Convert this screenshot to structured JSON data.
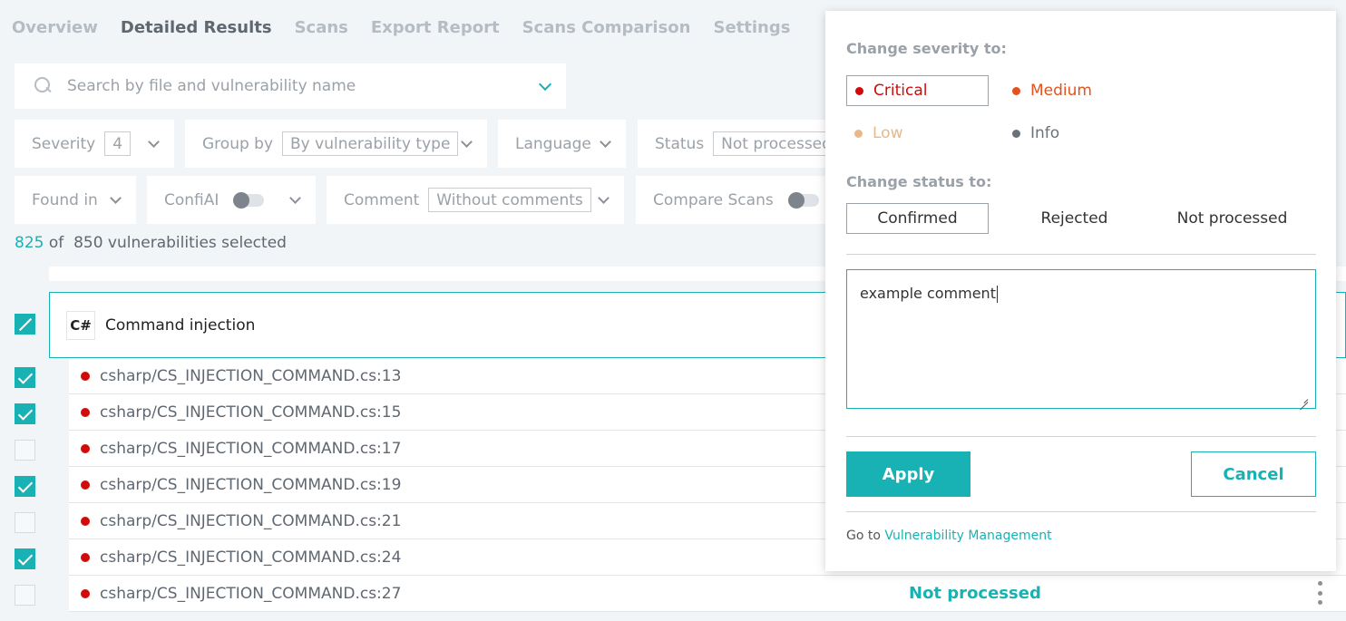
{
  "tabs": [
    {
      "label": "Overview"
    },
    {
      "label": "Detailed Results"
    },
    {
      "label": "Scans"
    },
    {
      "label": "Export Report"
    },
    {
      "label": "Scans Comparison"
    },
    {
      "label": "Settings"
    }
  ],
  "search": {
    "placeholder": "Search by file and vulnerability name"
  },
  "filters": {
    "severity": {
      "label": "Severity",
      "value": "4"
    },
    "group_by": {
      "label": "Group by",
      "value": "By vulnerability type"
    },
    "language": {
      "label": "Language"
    },
    "status": {
      "label": "Status",
      "value": "Not processed"
    },
    "found_in": {
      "label": "Found in"
    },
    "confiai": {
      "label": "ConfiAI"
    },
    "comment": {
      "label": "Comment",
      "value": "Without comments"
    },
    "compare_scans": {
      "label": "Compare Scans"
    }
  },
  "selection": {
    "selected": "825",
    "of_label": "of",
    "total_text": "850 vulnerabilities selected"
  },
  "group": {
    "lang_icon": "C#",
    "title": "Command injection"
  },
  "rows": [
    {
      "file": "csharp/CS_INJECTION_COMMAND.cs:13",
      "checked": true
    },
    {
      "file": "csharp/CS_INJECTION_COMMAND.cs:15",
      "checked": true
    },
    {
      "file": "csharp/CS_INJECTION_COMMAND.cs:17",
      "checked": false
    },
    {
      "file": "csharp/CS_INJECTION_COMMAND.cs:19",
      "checked": true
    },
    {
      "file": "csharp/CS_INJECTION_COMMAND.cs:21",
      "checked": false
    },
    {
      "file": "csharp/CS_INJECTION_COMMAND.cs:24",
      "checked": true
    },
    {
      "file": "csharp/CS_INJECTION_COMMAND.cs:27",
      "checked": false
    }
  ],
  "last_row_status": "Not processed",
  "panel": {
    "severity_heading": "Change severity to:",
    "severities": {
      "critical": {
        "label": "Critical",
        "color": "#d10a0a"
      },
      "medium": {
        "label": "Medium",
        "color": "#e5511a"
      },
      "low": {
        "label": "Low",
        "color": "#e8b78a"
      },
      "info": {
        "label": "Info",
        "color": "#6b7178"
      }
    },
    "status_heading": "Change status to:",
    "statuses": {
      "confirmed": "Confirmed",
      "rejected": "Rejected",
      "not_processed": "Not processed"
    },
    "comment_value": "example comment",
    "apply_label": "Apply",
    "cancel_label": "Cancel",
    "goto_prefix": "Go to",
    "goto_link": "Vulnerability Management"
  },
  "colors": {
    "accent": "#19b2b4",
    "critical": "#d10a0a"
  }
}
